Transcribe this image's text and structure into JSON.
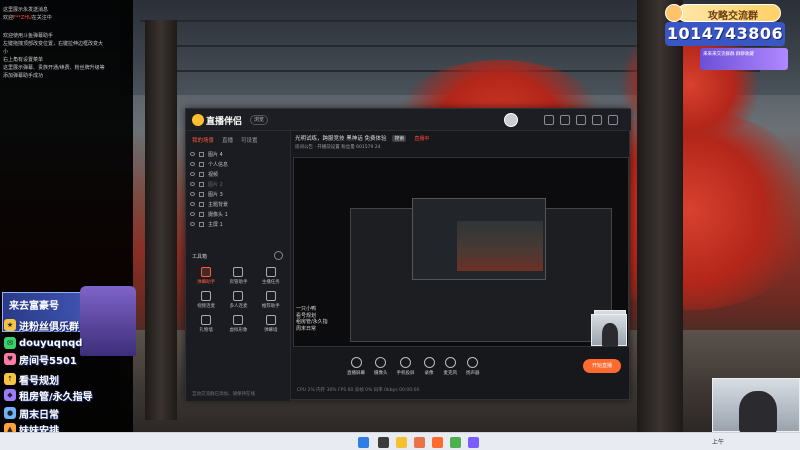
{
  "chat": {
    "lines": [
      {
        "text": "这里展示永发送消息",
        "hl": ""
      },
      {
        "text": "欢迎",
        "hl": "F**ZHU",
        "rest": "在关注中"
      },
      {
        "text": "",
        "hl": "",
        "gap": true
      },
      {
        "text": "欢迎使用斗鱼弹幕助手",
        "hl": ""
      },
      {
        "text": "左键拖拽顶部改变位置，右键拉伸边框改变大",
        "hl": ""
      },
      {
        "text": "小",
        "hl": ""
      },
      {
        "text": "右上角有设置菜单",
        "hl": ""
      },
      {
        "text": "这里展示弹幕、贵族开通/续费、粉丝牌升级等",
        "hl": ""
      },
      {
        "text": "添加弹幕助手成功",
        "hl": ""
      }
    ]
  },
  "overlay_left": {
    "banner_title": "来去富豪号",
    "rows": [
      {
        "icon": "★",
        "text": "进粉丝俱乐群"
      },
      {
        "icon": "✉",
        "text": "douyuqnqd"
      },
      {
        "icon": "♥",
        "text": "房间号5501"
      },
      {
        "icon": "↑",
        "text": "看号规划"
      },
      {
        "icon": "◆",
        "text": "租房管/永久指导"
      },
      {
        "icon": "●",
        "text": "周末日常"
      },
      {
        "icon": "▲",
        "text": "妹妹安排"
      }
    ]
  },
  "badge": {
    "title": "攻略交流群",
    "number": "1014743806",
    "mini": "来来来交流群群 群聊收藏"
  },
  "app": {
    "logo": "直播伴侣",
    "version_pill": "浏览",
    "header_pills": [
      "推荐",
      "直播管理"
    ],
    "side_tabs": [
      "我的场景",
      "直播",
      "可设置"
    ],
    "scenes": [
      {
        "name": "图片 4",
        "dim": false
      },
      {
        "name": "个人信息",
        "dim": false
      },
      {
        "name": "视频",
        "dim": false
      },
      {
        "name": "图片 2",
        "dim": true
      },
      {
        "name": "图片 3",
        "dim": false
      },
      {
        "name": "主题背景",
        "dim": false
      },
      {
        "name": "摄像头 1",
        "dim": false
      },
      {
        "name": "主屏 1",
        "dim": false
      }
    ],
    "tools_label": "工具箱",
    "tools": [
      {
        "label": "弹幕助手",
        "active": true
      },
      {
        "label": "房管助手",
        "active": false
      },
      {
        "label": "主播任务",
        "active": false
      },
      {
        "label": "视频连麦",
        "active": false
      },
      {
        "label": "多人连麦",
        "active": false
      },
      {
        "label": "推荐助手",
        "active": false
      },
      {
        "label": "礼物墙",
        "active": false
      },
      {
        "label": "虚拟形象",
        "active": false
      },
      {
        "label": "弹幕墙",
        "active": false
      }
    ],
    "side_footer": "互动交流群已添加，请保持在线",
    "room_title": "光明试练，跨服竞技 黑神话 免费体验",
    "room_tag1": "搜索",
    "room_tag2": "直播中",
    "room_sub": "房间公告 · 开播前设置   粉丝量 601579   24",
    "preview_chat": [
      "一只小鸭",
      "看号规划",
      "租房管/永久指",
      "周末日常"
    ],
    "bottom_buttons": [
      "直播屏幕",
      "摄像头",
      "手机投屏",
      "录像",
      "麦克风",
      "扬声器"
    ],
    "start_label": "开始直播",
    "status": "CPU 2%  内存 30%  FPS 60  丢帧 0%  码率 0kbps   00:00:00"
  },
  "taskbar": {
    "time": "上午"
  }
}
